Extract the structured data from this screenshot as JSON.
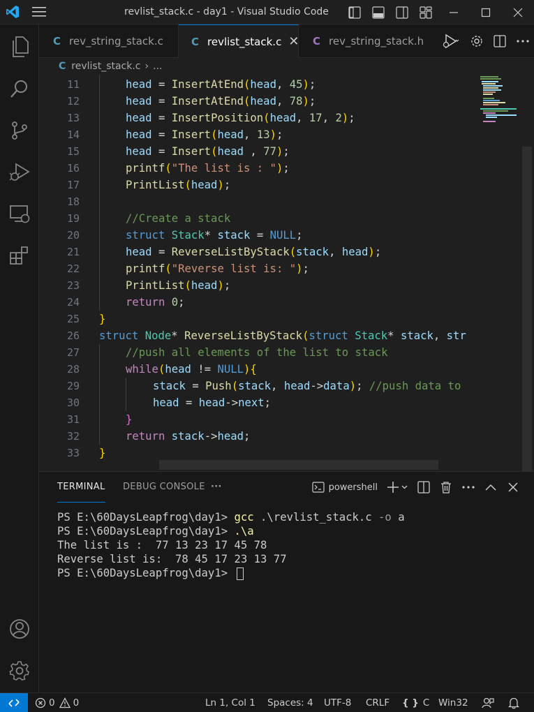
{
  "window": {
    "title": "revlist_stack.c - day1 - Visual Studio Code"
  },
  "tabs": [
    {
      "label": "rev_string_stack.c",
      "lang": "C"
    },
    {
      "label": "revlist_stack.c",
      "lang": "C",
      "active": true
    },
    {
      "label": "rev_string_stack.h",
      "lang": "C"
    }
  ],
  "breadcrumb": {
    "lang": "C",
    "file": "revlist_stack.c",
    "more": "..."
  },
  "editor": {
    "line_numbers": [
      "11",
      "12",
      "13",
      "14",
      "15",
      "16",
      "17",
      "18",
      "19",
      "20",
      "21",
      "22",
      "23",
      "24",
      "25",
      "26",
      "27",
      "28",
      "29",
      "30",
      "31",
      "32",
      "33"
    ],
    "lines": [
      "head = InsertAtEnd(head, 45);",
      "head = InsertAtEnd(head, 78);",
      "head = InsertPosition(head, 17, 2);",
      "head = Insert(head, 13);",
      "head = Insert(head , 77);",
      "printf(\"The list is : \");",
      "PrintList(head);",
      "",
      "//Create a stack",
      "struct Stack* stack = NULL;",
      "head = ReverseListByStack(stack, head);",
      "printf(\"Reverse list is: \");",
      "PrintList(head);",
      "return 0;",
      "}",
      "struct Node* ReverseListByStack(struct Stack* stack, str",
      "//push all elements of the list to stack",
      "while(head != NULL){",
      "stack = Push(stack, head->data); //push data to",
      "head = head->next;",
      "}",
      "return stack->head;",
      "}"
    ]
  },
  "panel": {
    "tabs": [
      "TERMINAL",
      "DEBUG CONSOLE"
    ],
    "more": "···",
    "shell": "powershell",
    "terminal_lines": [
      {
        "prompt": "PS E:\\60DaysLeapfrog\\day1> ",
        "cmd": "gcc",
        "args": " .\\revlist_stack.c ",
        "flag": "-o",
        "rest": " a"
      },
      {
        "prompt": "PS E:\\60DaysLeapfrog\\day1> ",
        "cmd": ".\\a"
      },
      {
        "text": "The list is :  77 13 23 17 45 78"
      },
      {
        "text": "Reverse list is:  78 45 17 23 13 77"
      },
      {
        "prompt": "PS E:\\60DaysLeapfrog\\day1> "
      }
    ]
  },
  "statusbar": {
    "errors": "0",
    "warnings": "0",
    "position": "Ln 1, Col 1",
    "spaces": "Spaces: 4",
    "encoding": "UTF-8",
    "eol": "CRLF",
    "language": "C",
    "platform": "Win32"
  },
  "colors": {
    "accent": "#0078d4",
    "background": "#1f1f1f",
    "keyword": "#569cd6",
    "function": "#dcdcaa",
    "variable": "#9cdcfe",
    "type": "#4ec9b0",
    "number": "#b5cea8",
    "string": "#ce9178",
    "comment": "#6a9955"
  }
}
